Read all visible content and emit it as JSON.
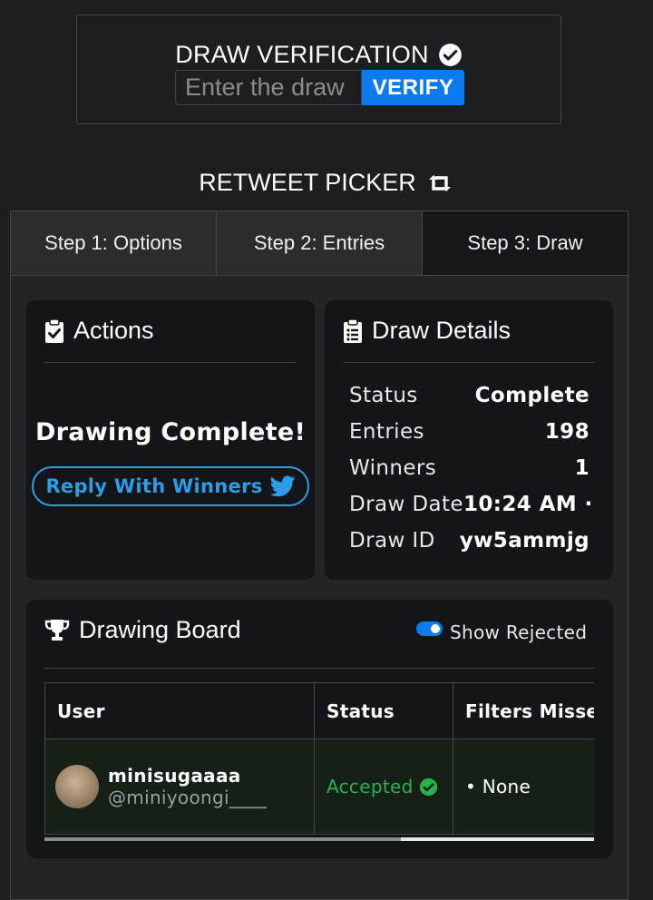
{
  "verification": {
    "title": "DRAW VERIFICATION",
    "input_placeholder": "Enter the draw",
    "verify_label": "VERIFY"
  },
  "picker": {
    "title": "RETWEET PICKER"
  },
  "tabs": [
    {
      "label": "Step 1: Options",
      "active": false
    },
    {
      "label": "Step 2: Entries",
      "active": false
    },
    {
      "label": "Step 3: Draw",
      "active": true
    }
  ],
  "actions": {
    "title": "Actions",
    "status_text": "Drawing Complete!",
    "reply_label": "Reply With Winners"
  },
  "draw_details": {
    "title": "Draw Details",
    "rows": [
      {
        "label": "Status",
        "value": "Complete"
      },
      {
        "label": "Entries",
        "value": "198"
      },
      {
        "label": "Winners",
        "value": "1"
      },
      {
        "label": "Draw Date",
        "value": "10:24 AM ·"
      },
      {
        "label": "Draw ID",
        "value": "yw5ammjg"
      }
    ]
  },
  "board": {
    "title": "Drawing Board",
    "toggle_label": "Show Rejected",
    "toggle_on": true,
    "columns": [
      "User",
      "Status",
      "Filters Missed"
    ],
    "rows": [
      {
        "name": "minisugaaaa",
        "handle": "@miniyoongi____",
        "status": "Accepted",
        "filters": "• None"
      }
    ]
  },
  "colors": {
    "accent_blue": "#0d7bf0",
    "twitter_blue": "#2c9dea",
    "accepted_green": "#2bb24c"
  }
}
